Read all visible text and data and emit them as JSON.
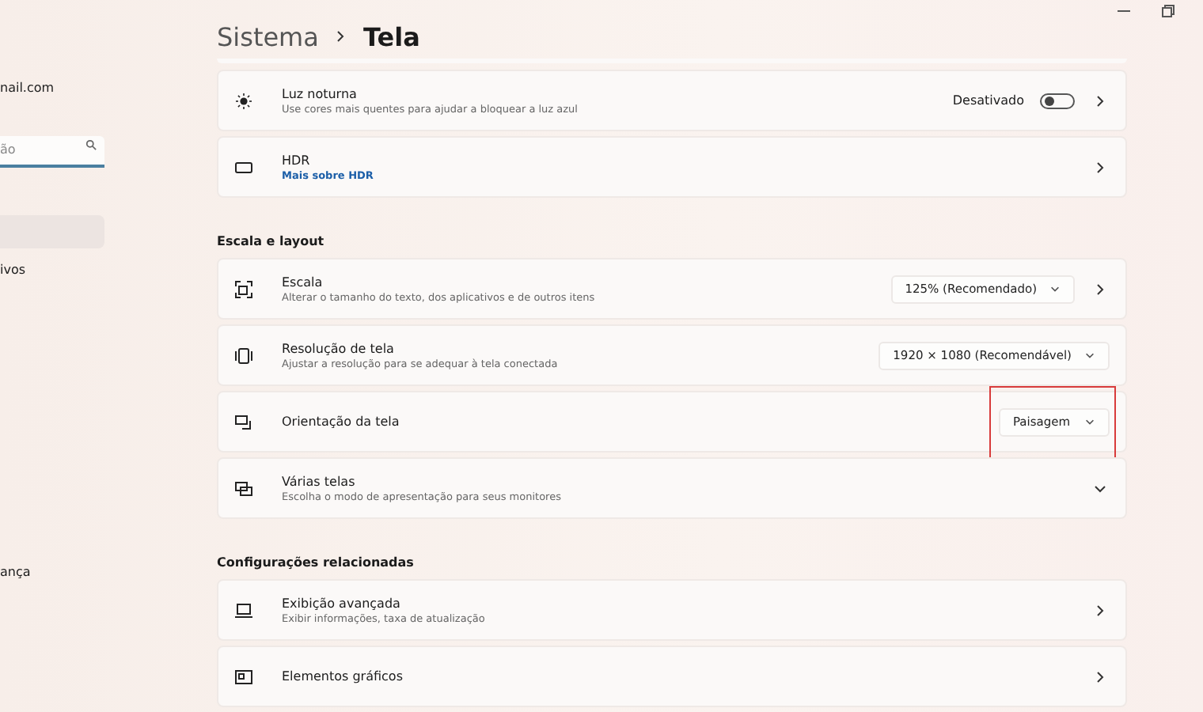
{
  "sidebar": {
    "account_email": "nail.com",
    "search": {
      "placeholder": "ão"
    },
    "items": [
      "ivos",
      "ança"
    ]
  },
  "breadcrumb": {
    "parent": "Sistema",
    "current": "Tela"
  },
  "groups": [
    {
      "rows": [
        {
          "kind": "toggle",
          "title": "Luz noturna",
          "subtitle": "Use cores mais quentes para ajudar a bloquear a luz azul",
          "state_label": "Desativado",
          "on": false,
          "chevron": true
        },
        {
          "kind": "link",
          "title": "HDR",
          "link": "Mais sobre HDR",
          "chevron": true
        }
      ]
    },
    {
      "heading": "Escala e layout",
      "rows": [
        {
          "kind": "dropdown",
          "title": "Escala",
          "subtitle": "Alterar o tamanho do texto, dos aplicativos e de outros itens",
          "value": "125% (Recomendado)",
          "chevron": true,
          "highlighted": false
        },
        {
          "kind": "dropdown",
          "title": "Resolução de tela",
          "subtitle": "Ajustar a resolução para se adequar à tela conectada",
          "value": "1920 × 1080 (Recomendável)",
          "chevron": false,
          "highlighted": false
        },
        {
          "kind": "dropdown",
          "title": "Orientação da tela",
          "value": "Paisagem",
          "chevron": false,
          "highlighted": true
        },
        {
          "kind": "expand",
          "title": "Várias telas",
          "subtitle": "Escolha o modo de apresentação para seus monitores"
        }
      ]
    },
    {
      "heading": "Configurações relacionadas",
      "rows": [
        {
          "kind": "nav",
          "title": "Exibição avançada",
          "subtitle": "Exibir informações, taxa de atualização",
          "chevron": true
        },
        {
          "kind": "nav",
          "title": "Elementos gráficos",
          "chevron": true
        }
      ]
    }
  ]
}
